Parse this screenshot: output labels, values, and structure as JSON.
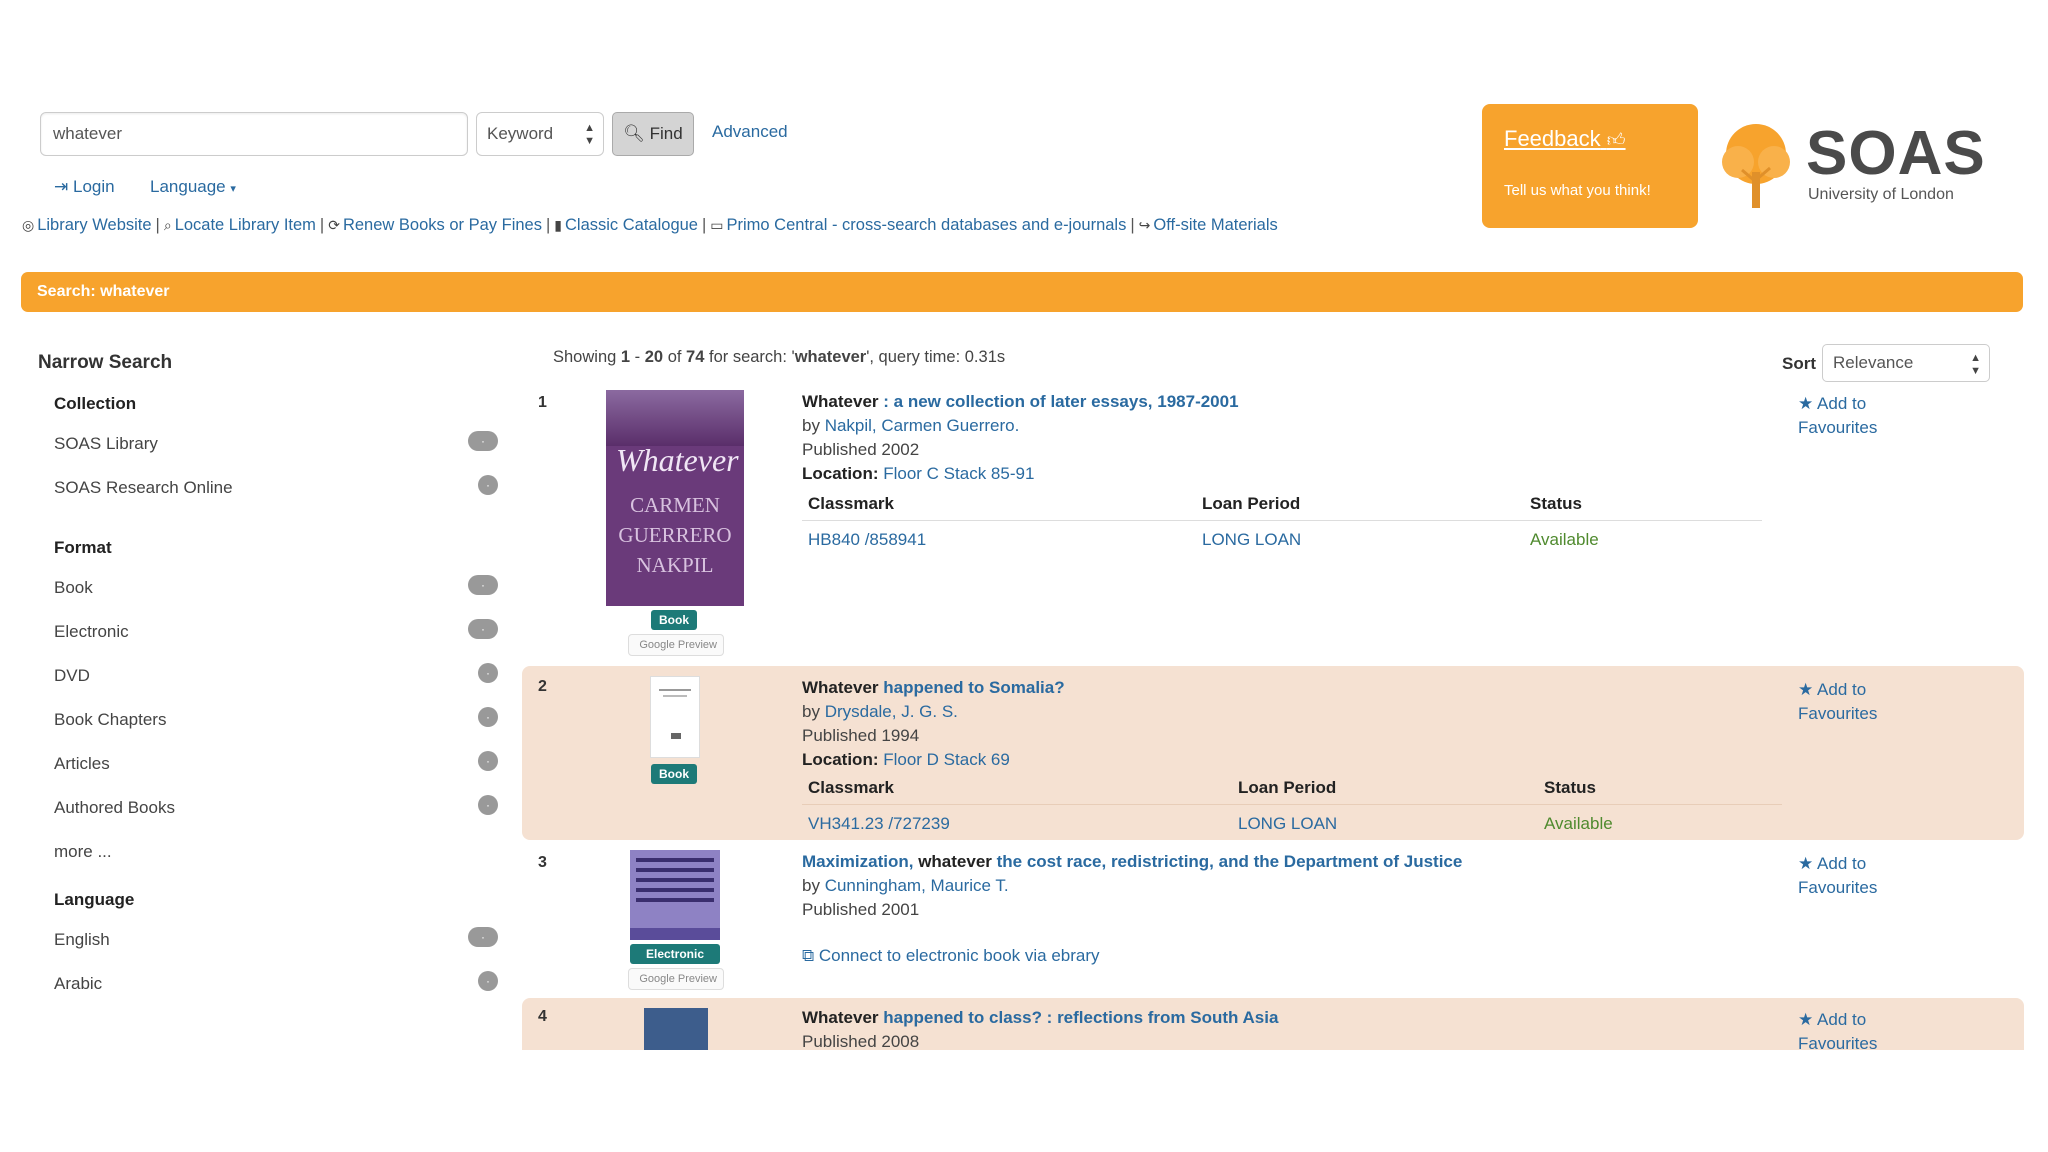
{
  "search": {
    "query": "whatever",
    "type": "Keyword",
    "find_label": "Find",
    "advanced_label": "Advanced"
  },
  "user": {
    "login_label": "Login",
    "language_label": "Language"
  },
  "quicklinks": [
    {
      "icon": "globe-icon",
      "label": "Library Website"
    },
    {
      "icon": "search-icon",
      "label": "Locate Library Item"
    },
    {
      "icon": "refresh-icon",
      "label": "Renew Books or Pay Fines"
    },
    {
      "icon": "book-icon",
      "label": "Classic Catalogue"
    },
    {
      "icon": "monitor-icon",
      "label": "Primo Central - cross-search databases and e-journals"
    },
    {
      "icon": "share-icon",
      "label": "Off-site Materials"
    }
  ],
  "feedback": {
    "title": "Feedback",
    "subtitle": "Tell us what you think!"
  },
  "logo": {
    "name": "SOAS",
    "subtitle": "University of London"
  },
  "banner": "Search: whatever",
  "sidebar": {
    "title": "Narrow Search",
    "more_label": "more ...",
    "groups": [
      {
        "label": "Collection",
        "items": [
          {
            "label": "SOAS Library",
            "count": "·"
          },
          {
            "label": "SOAS Research Online",
            "count": "·"
          }
        ]
      },
      {
        "label": "Format",
        "items": [
          {
            "label": "Book",
            "count": "·"
          },
          {
            "label": "Electronic",
            "count": "·"
          },
          {
            "label": "DVD",
            "count": "·"
          },
          {
            "label": "Book Chapters",
            "count": "·"
          },
          {
            "label": "Articles",
            "count": "·"
          },
          {
            "label": "Authored Books",
            "count": "·"
          }
        ]
      },
      {
        "label": "Language",
        "items": [
          {
            "label": "English",
            "count": "·"
          },
          {
            "label": "Arabic",
            "count": "·"
          }
        ]
      }
    ]
  },
  "results_header": {
    "prefix": "Showing ",
    "start": "1",
    "dash": " - ",
    "end": "20",
    "of": " of ",
    "total": "74",
    "for": " for search: '",
    "query": "whatever",
    "suffix": "', query time: 0.31s",
    "sort_label": "Sort",
    "sort_value": "Relevance"
  },
  "fav_line1": "Add to",
  "fav_line2": "Favourites",
  "table_headers": {
    "classmark": "Classmark",
    "loan": "Loan Period",
    "status": "Status"
  },
  "results": [
    {
      "num": "1",
      "title_bold": "Whatever",
      "title_rest": " : a new collection of later essays, 1987-2001",
      "by_prefix": "by ",
      "author": "Nakpil, Carmen Guerrero.",
      "published": "Published 2002",
      "location_label": "Location: ",
      "location": "Floor C Stack 85-91",
      "classmark": "HB840 /858941",
      "loan": "LONG LOAN",
      "status": "Available",
      "format": "Book",
      "cover_text": [
        "Whatever",
        "CARMEN",
        "GUERRERO",
        "NAKPIL"
      ]
    },
    {
      "num": "2",
      "title_bold": "Whatever",
      "title_rest": " happened to Somalia?",
      "by_prefix": "by ",
      "author": "Drysdale, J. G. S.",
      "published": "Published 1994",
      "location_label": "Location: ",
      "location": "Floor D Stack 69",
      "classmark": "VH341.23 /727239",
      "loan": "LONG LOAN",
      "status": "Available",
      "format": "Book"
    },
    {
      "num": "3",
      "title_link1": "Maximization, ",
      "title_bold": "whatever",
      "title_rest": " the cost race, redistricting, and the Department of Justice",
      "by_prefix": "by ",
      "author": "Cunningham, Maurice T.",
      "published": "Published 2001",
      "connect": "Connect to electronic book via ebrary",
      "format": "Electronic"
    },
    {
      "num": "4",
      "title_bold": "Whatever",
      "title_rest": " happened to class? : reflections from South Asia",
      "published": "Published 2008"
    }
  ],
  "google_preview": "Google Preview",
  "colors": {
    "accent": "#f7a32d",
    "link": "#2a6aa0",
    "available": "#4f8a2e",
    "badge": "#1d7a78",
    "row_alt": "#f5e1d2"
  }
}
